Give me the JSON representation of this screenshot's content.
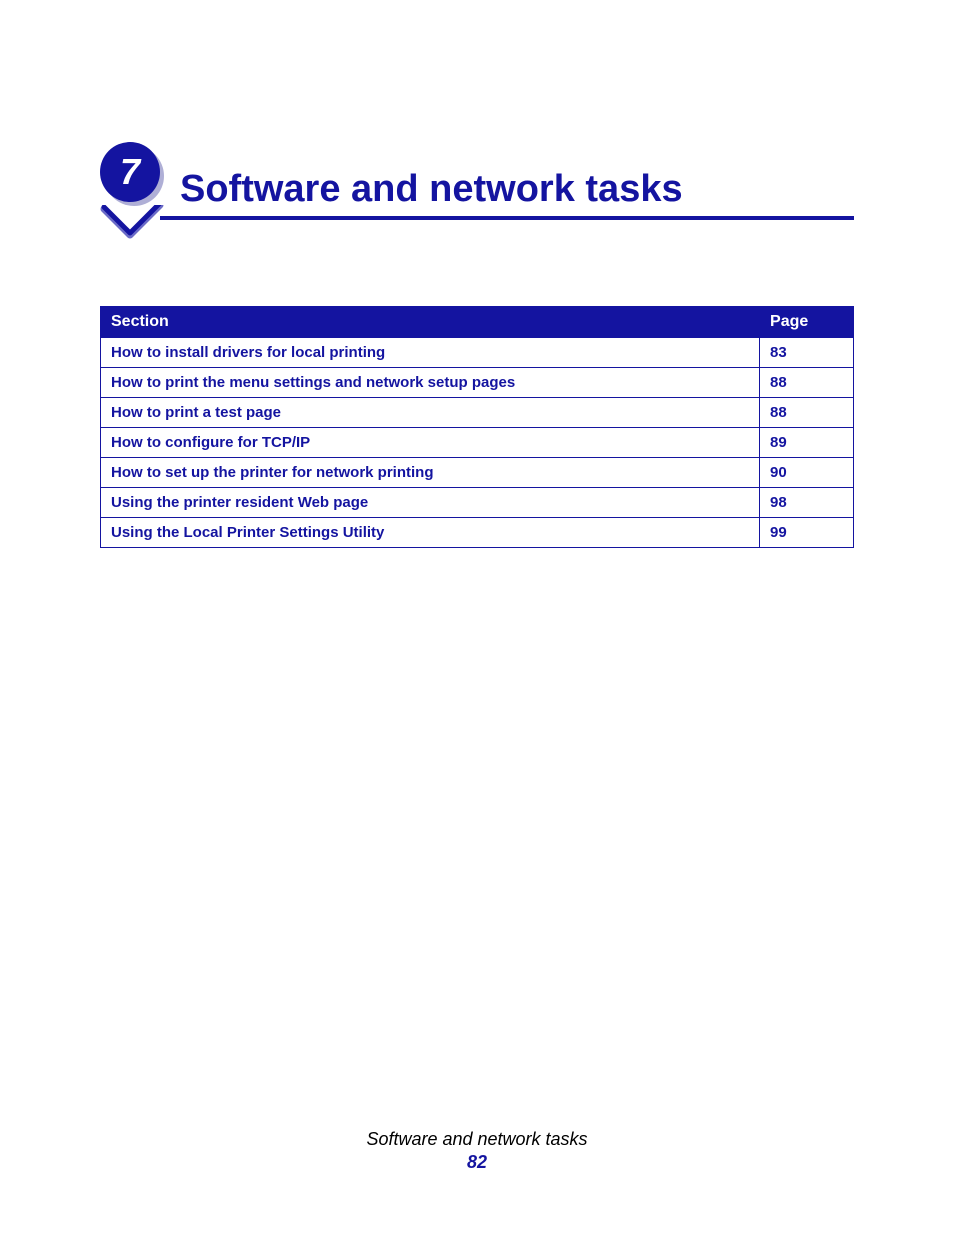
{
  "chapter": {
    "number": "7",
    "title": "Software and network tasks"
  },
  "table": {
    "headers": {
      "section": "Section",
      "page": "Page"
    },
    "rows": [
      {
        "section": "How to install drivers for local printing",
        "page": "83"
      },
      {
        "section": "How to print the menu settings and network setup pages",
        "page": "88"
      },
      {
        "section": "How to print a test page",
        "page": "88"
      },
      {
        "section": "How to configure for TCP/IP",
        "page": "89"
      },
      {
        "section": "How to set up the printer for network printing",
        "page": "90"
      },
      {
        "section": "Using the printer resident Web page",
        "page": "98"
      },
      {
        "section": "Using the Local Printer Settings Utility",
        "page": "99"
      }
    ]
  },
  "footer": {
    "title": "Software and network tasks",
    "page": "82"
  }
}
